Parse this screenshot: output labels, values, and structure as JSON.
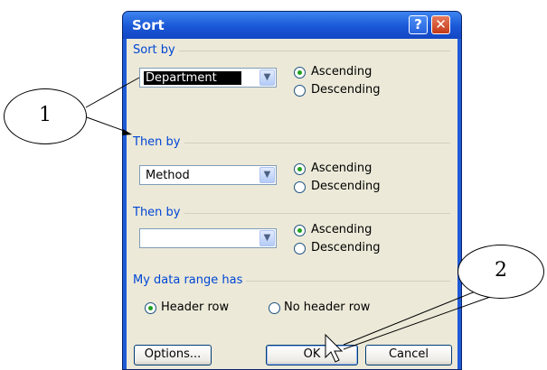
{
  "dialog": {
    "title": "Sort",
    "help_glyph": "?",
    "close_glyph": "✕"
  },
  "sort_by": {
    "group_label": "Sort by",
    "value": "Department",
    "ascending_label": "Ascending",
    "descending_label": "Descending",
    "selected": "ascending"
  },
  "then_by_1": {
    "group_label": "Then by",
    "value": "Method",
    "ascending_label": "Ascending",
    "descending_label": "Descending",
    "selected": "ascending"
  },
  "then_by_2": {
    "group_label": "Then by",
    "value": "",
    "ascending_label": "Ascending",
    "descending_label": "Descending",
    "selected": "ascending"
  },
  "data_range": {
    "group_label": "My data range has",
    "header_row_label": "Header row",
    "no_header_row_label": "No header row",
    "selected": "header_row"
  },
  "buttons": {
    "options": "Options...",
    "ok": "OK",
    "cancel": "Cancel"
  },
  "callouts": {
    "one": "1",
    "two": "2"
  },
  "icons": {
    "dropdown": "chevron-down-icon",
    "cursor": "mouse-pointer-icon"
  }
}
